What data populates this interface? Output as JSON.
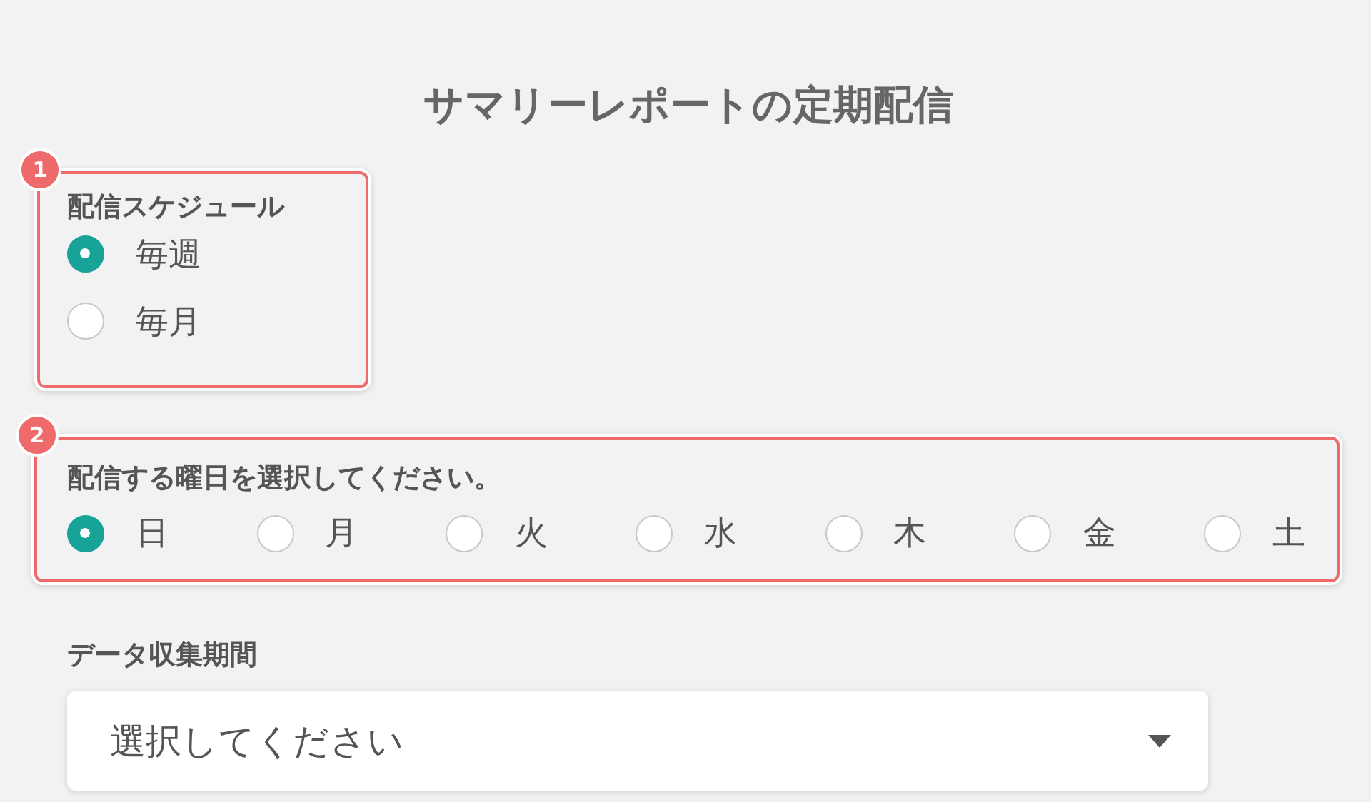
{
  "title": "サマリーレポートの定期配信",
  "sections": [
    {
      "badge": "1",
      "label": "配信スケジュール",
      "kind": "column",
      "options": [
        {
          "label": "毎週",
          "selected": true
        },
        {
          "label": "毎月",
          "selected": false
        }
      ]
    },
    {
      "badge": "2",
      "label": "配信する曜日を選択してください。",
      "kind": "row",
      "options": [
        {
          "label": "日",
          "selected": true
        },
        {
          "label": "月",
          "selected": false
        },
        {
          "label": "火",
          "selected": false
        },
        {
          "label": "水",
          "selected": false
        },
        {
          "label": "木",
          "selected": false
        },
        {
          "label": "金",
          "selected": false
        },
        {
          "label": "土",
          "selected": false
        }
      ]
    }
  ],
  "period": {
    "label": "データ収集期間",
    "placeholder": "選択してください"
  }
}
